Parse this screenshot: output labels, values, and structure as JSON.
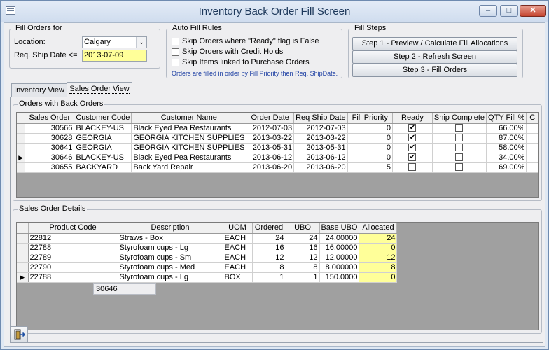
{
  "window": {
    "title": "Inventory Back Order Fill Screen",
    "min_glyph": "–",
    "max_glyph": "□",
    "close_glyph": "✕"
  },
  "fill_orders_for": {
    "legend": "Fill Orders for",
    "location_label": "Location:",
    "location_value": "Calgary",
    "ship_date_label": "Req. Ship Date <=",
    "ship_date_value": "2013-07-09"
  },
  "auto_fill_rules": {
    "legend": "Auto Fill Rules",
    "options": [
      {
        "label": "Skip Orders where \"Ready\" flag is False",
        "checked": false
      },
      {
        "label": "Skip Orders with Credit Holds",
        "checked": false
      },
      {
        "label": "Skip Items linked to Purchase Orders",
        "checked": false
      }
    ],
    "note": "Orders are filled in order by Fill Priority then Req. ShipDate."
  },
  "fill_steps": {
    "legend": "Fill Steps",
    "buttons": [
      "Step 1 - Preview / Calculate Fill Allocations",
      "Step 2 - Refresh Screen",
      "Step 3 - Fill Orders"
    ]
  },
  "tabs": {
    "inventory": "Inventory View",
    "sales": "Sales Order View"
  },
  "orders": {
    "legend": "Orders with Back Orders",
    "columns": [
      "Sales Order",
      "Customer Code",
      "Customer Name",
      "Order Date",
      "Req Ship Date",
      "Fill Priority",
      "Ready",
      "Ship Complete",
      "QTY Fill %",
      "C"
    ],
    "rows": [
      {
        "current": false,
        "so": "30566",
        "code": "BLACKEY-US",
        "name": "Black Eyed Pea Restaurants",
        "order_date": "2012-07-03",
        "ship_date": "2012-07-03",
        "priority": "0",
        "ready": true,
        "ship_complete": false,
        "fill": "66.00%"
      },
      {
        "current": false,
        "so": "30628",
        "code": "GEORGIA",
        "name": "GEORGIA KITCHEN SUPPLIES",
        "order_date": "2013-03-22",
        "ship_date": "2013-03-22",
        "priority": "0",
        "ready": true,
        "ship_complete": false,
        "fill": "87.00%"
      },
      {
        "current": false,
        "so": "30641",
        "code": "GEORGIA",
        "name": "GEORGIA KITCHEN SUPPLIES",
        "order_date": "2013-05-31",
        "ship_date": "2013-05-31",
        "priority": "0",
        "ready": true,
        "ship_complete": false,
        "fill": "58.00%"
      },
      {
        "current": true,
        "so": "30646",
        "code": "BLACKEY-US",
        "name": "Black Eyed Pea Restaurants",
        "order_date": "2013-06-12",
        "ship_date": "2013-06-12",
        "priority": "0",
        "ready": true,
        "ship_complete": false,
        "fill": "34.00%"
      },
      {
        "current": false,
        "so": "30655",
        "code": "BACKYARD",
        "name": "Back Yard Repair",
        "order_date": "2013-06-20",
        "ship_date": "2013-06-20",
        "priority": "5",
        "ready": false,
        "ship_complete": false,
        "fill": "69.00%"
      }
    ]
  },
  "details": {
    "legend": "Sales Order Details",
    "order_id": "30646",
    "columns": [
      "Product Code",
      "Description",
      "UOM",
      "Ordered",
      "UBO",
      "Base UBO",
      "Allocated"
    ],
    "rows": [
      {
        "current": false,
        "code": "22812",
        "desc": "Straws - Box",
        "uom": "EACH",
        "ordered": "24",
        "ubo": "24",
        "base_ubo": "24.00000",
        "allocated": "24"
      },
      {
        "current": false,
        "code": "22788",
        "desc": "Styrofoam cups - Lg",
        "uom": "EACH",
        "ordered": "16",
        "ubo": "16",
        "base_ubo": "16.00000",
        "allocated": "0"
      },
      {
        "current": false,
        "code": "22789",
        "desc": "Styrofoam cups - Sm",
        "uom": "EACH",
        "ordered": "12",
        "ubo": "12",
        "base_ubo": "12.00000",
        "allocated": "12"
      },
      {
        "current": false,
        "code": "22790",
        "desc": "Styrofoam cups - Med",
        "uom": "EACH",
        "ordered": "8",
        "ubo": "8",
        "base_ubo": "8.000000",
        "allocated": "8"
      },
      {
        "current": true,
        "code": "22788",
        "desc": "Styrofoam cups - Lg",
        "uom": "BOX",
        "ordered": "1",
        "ubo": "1",
        "base_ubo": "150.0000",
        "allocated": "0"
      }
    ]
  },
  "colors": {
    "highlight": "#ffff99",
    "title_text": "#1e395b",
    "note_text": "#1d3fa3"
  },
  "icons": {
    "exit": "exit-door-icon",
    "current_row": "▶",
    "check": "✔",
    "scroll_left": "❮",
    "scroll_right": "❯",
    "combo_arrow": "⌄"
  }
}
